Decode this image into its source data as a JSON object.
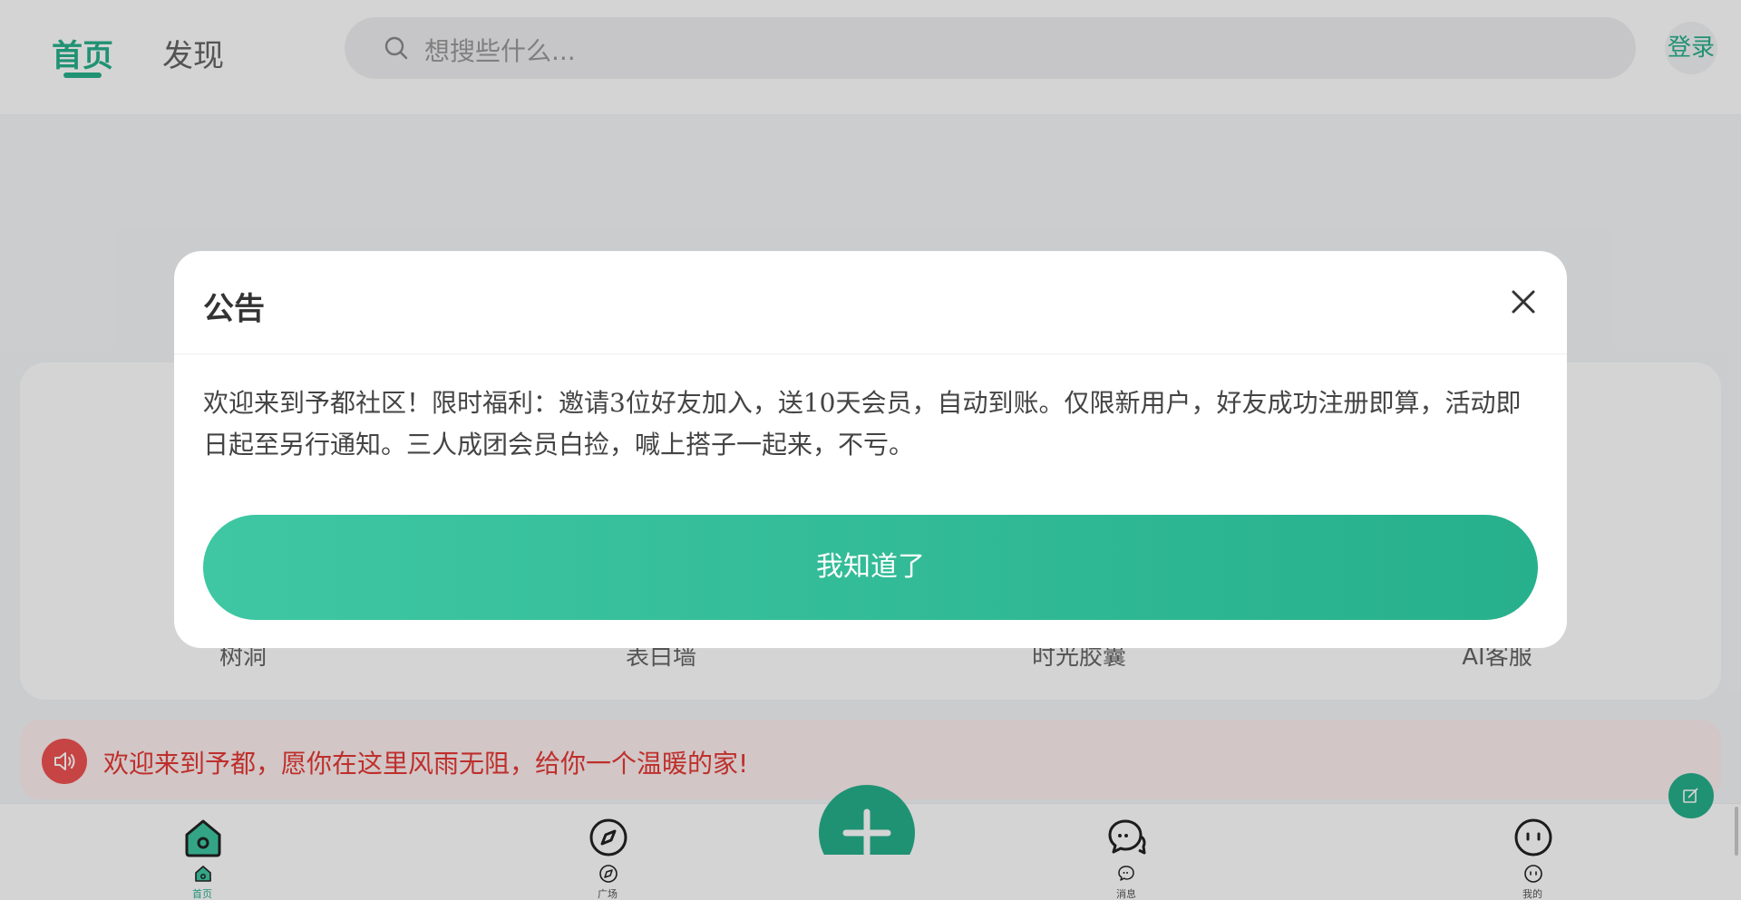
{
  "header": {
    "tabs": [
      {
        "label": "首页",
        "active": true
      },
      {
        "label": "发现",
        "active": false
      }
    ],
    "search": {
      "placeholder": "想搜些什么..."
    },
    "login_label": "登录"
  },
  "entries": [
    {
      "label": "树洞"
    },
    {
      "label": "表白墙"
    },
    {
      "label": "时光胶囊"
    },
    {
      "label": "AI客服"
    }
  ],
  "notice": {
    "text": "欢迎来到予都，愿你在这里风雨无阻，给你一个温暖的家!",
    "color": "#e53935"
  },
  "tabbar": {
    "items": [
      {
        "label": "首页",
        "icon": "home-icon",
        "active": true
      },
      {
        "label": "广场",
        "icon": "compass-icon",
        "active": false
      },
      {
        "label": "消息",
        "icon": "chat-icon",
        "active": false
      },
      {
        "label": "我的",
        "icon": "profile-icon",
        "active": false
      }
    ],
    "fab_icon": "plus-icon"
  },
  "modal": {
    "title": "公告",
    "body": "欢迎来到予都社区！限时福利：邀请3位好友加入，送10天会员，自动到账。仅限新用户，好友成功注册即算，活动即日起至另行通知。三人成团会员白捡，喊上搭子一起来，不亏。",
    "button_label": "我知道了"
  },
  "colors": {
    "accent": "#27b08c",
    "notice_red": "#f05252"
  }
}
